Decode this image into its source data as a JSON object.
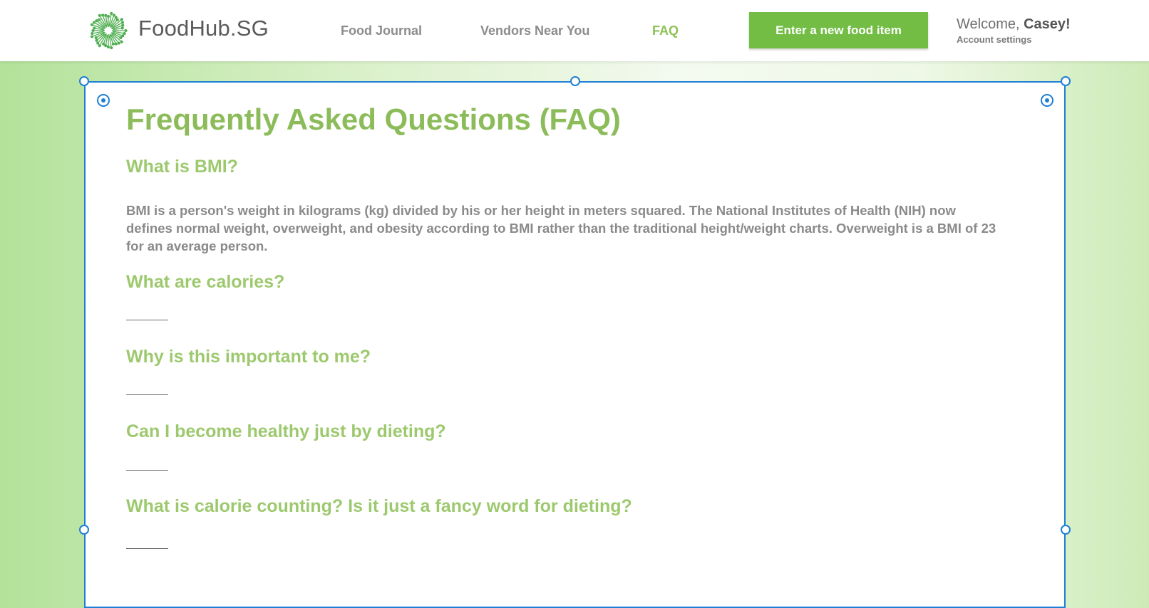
{
  "header": {
    "brand": "FoodHub.SG",
    "nav": [
      "Food Journal",
      "Vendors Near You",
      "FAQ"
    ],
    "active_nav": "FAQ",
    "cta_label": "Enter a new food item",
    "welcome_prefix": "Welcome, ",
    "user_name": "Casey!",
    "account_link": "Account settings"
  },
  "faq": {
    "title": "Frequently Asked Questions (FAQ)",
    "items": [
      {
        "question": "What is BMI?",
        "answer": "BMI is a person's weight in kilograms (kg) divided by his or her height in meters squared. The National Institutes of Health (NIH) now defines normal weight, overweight, and obesity according to BMI rather than the traditional height/weight charts. Overweight is a BMI of 23 for an average person."
      },
      {
        "question": "What are calories?",
        "answer": ""
      },
      {
        "question": "Why is this important to me?",
        "answer": ""
      },
      {
        "question": "Can I become healthy just by dieting?",
        "answer": ""
      },
      {
        "question": "What is calorie counting? Is it just a fancy word for dieting?",
        "answer": ""
      }
    ]
  },
  "colors": {
    "accent_green": "#8cbc5a",
    "button_green": "#73bd45",
    "selection_blue": "#1e7fd4"
  },
  "icons": {
    "logo": "dandelion-logo-icon",
    "selection_handle": "resize-handle-icon",
    "anchor": "anchor-point-icon"
  }
}
